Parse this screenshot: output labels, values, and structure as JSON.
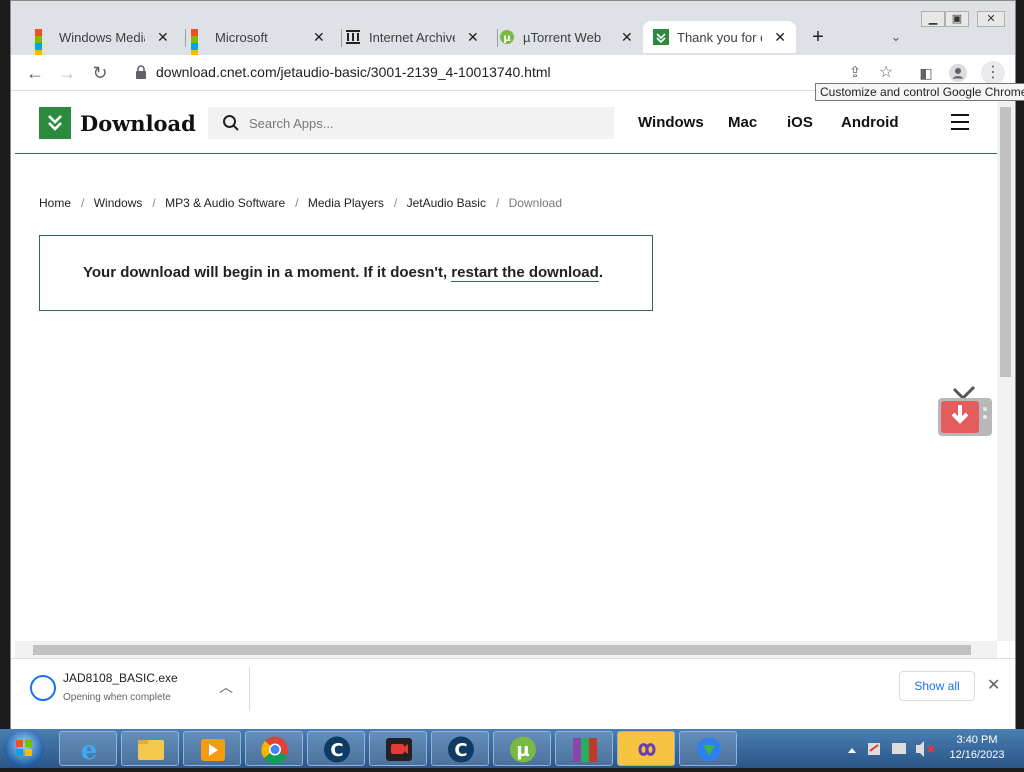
{
  "browser": {
    "tabs": [
      {
        "title": "Windows Media",
        "favicon": "microsoft-icon",
        "active": false
      },
      {
        "title": "Microsoft",
        "favicon": "microsoft-icon",
        "active": false
      },
      {
        "title": "Internet Archive",
        "favicon": "archive-icon",
        "active": false
      },
      {
        "title": "µTorrent Web",
        "favicon": "utorrent-icon",
        "active": false
      },
      {
        "title": "Thank you for do",
        "favicon": "download-icon",
        "active": true
      }
    ],
    "url": "download.cnet.com/jetaudio-basic/3001-2139_4-10013740.html",
    "tooltip": "Customize and control Google Chrome"
  },
  "site": {
    "logo_text": "Download",
    "search_placeholder": "Search Apps...",
    "nav": [
      "Windows",
      "Mac",
      "iOS",
      "Android"
    ],
    "breadcrumb": [
      "Home",
      "Windows",
      "MP3 & Audio Software",
      "Media Players",
      "JetAudio Basic",
      "Download"
    ],
    "message_prefix": "Your download will begin in a moment. If it doesn't, ",
    "message_link": "restart the download",
    "message_suffix": "."
  },
  "download_bar": {
    "filename": "JAD8108_BASIC.exe",
    "status": "Opening when complete",
    "show_all": "Show all"
  },
  "taskbar": {
    "time": "3:40 PM",
    "date": "12/16/2023"
  },
  "colors": {
    "brand_green": "#2b8a3e",
    "chrome_blue": "#1a73e8",
    "taskbar": "#2b5587"
  }
}
